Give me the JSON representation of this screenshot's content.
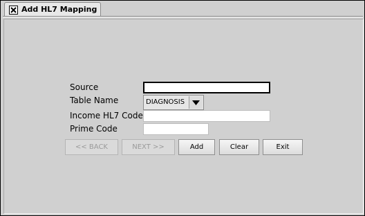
{
  "tab": {
    "label": "Add HL7 Mapping",
    "icon": "close-icon"
  },
  "form": {
    "source_label": "Source",
    "source_value": "",
    "table_name_label": "Table Name",
    "table_name_value": "DIAGNOSIS",
    "income_code_label": "Income HL7 Code",
    "income_code_value": "",
    "prime_code_label": "Prime Code",
    "prime_code_value": ""
  },
  "buttons": {
    "back": "<< BACK",
    "next": "NEXT >>",
    "add": "Add",
    "clear": "Clear",
    "exit": "Exit"
  }
}
